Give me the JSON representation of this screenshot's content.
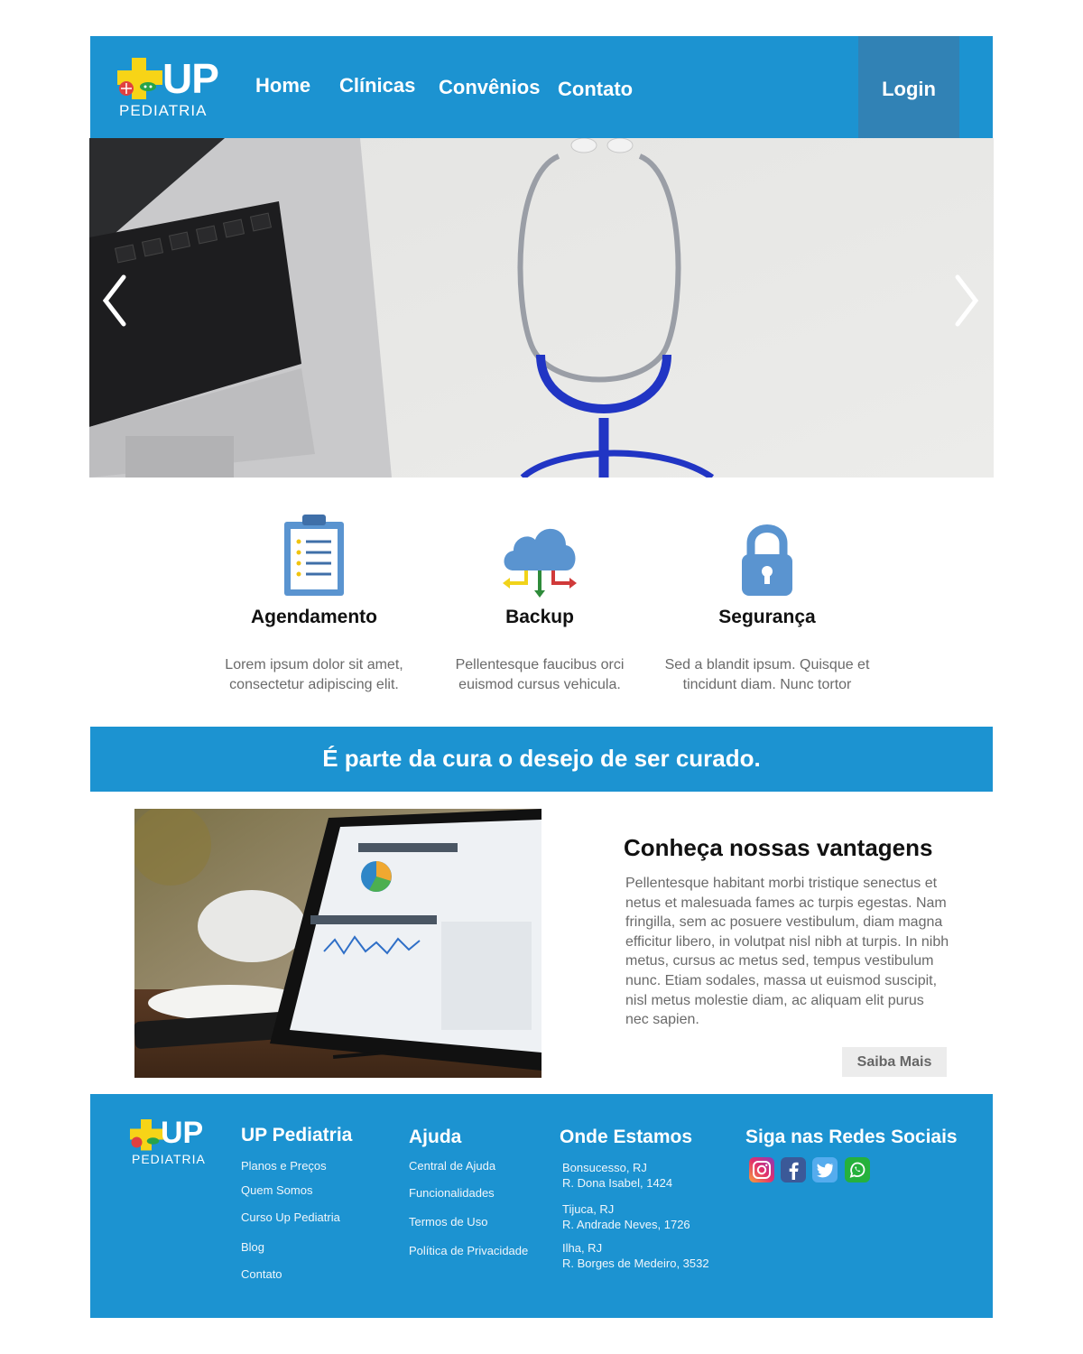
{
  "brand": {
    "mark": "UP",
    "name": "PEDIATRIA"
  },
  "nav": {
    "home": "Home",
    "clinicas": "Clínicas",
    "convenios": "Convênios",
    "contato": "Contato",
    "login": "Login"
  },
  "features": [
    {
      "title": "Agendamento",
      "line1": "Lorem ipsum dolor sit amet,",
      "line2": "consectetur adipiscing elit."
    },
    {
      "title": "Backup",
      "line1": "Pellentesque faucibus orci",
      "line2": "euismod cursus vehicula."
    },
    {
      "title": "Segurança",
      "line1": "Sed a blandit ipsum. Quisque et",
      "line2": "tincidunt diam. Nunc tortor"
    }
  ],
  "banner": {
    "text": "É parte da cura o desejo de ser curado."
  },
  "advantages": {
    "title": "Conheça nossas vantagens",
    "body": "Pellentesque habitant morbi tristique senectus et netus et malesuada fames ac turpis egestas. Nam fringilla, sem ac posuere vestibulum, diam magna efficitur libero, in volutpat nisl nibh at turpis. In nibh metus, cursus ac metus sed, tempus vestibulum nunc. Etiam sodales, massa ut euismod suscipit, nisl metus molestie diam, ac aliquam elit purus nec sapien.",
    "button": "Saiba Mais"
  },
  "footer": {
    "col1": {
      "title": "UP Pediatria",
      "links": [
        "Planos e Preços",
        "Quem Somos",
        "Curso Up Pediatria",
        "Blog",
        "Contato"
      ]
    },
    "col2": {
      "title": "Ajuda",
      "links": [
        "Central de Ajuda",
        "Funcionalidades",
        "Termos de Uso",
        "Política de Privacidade"
      ]
    },
    "col3": {
      "title": "Onde Estamos",
      "addresses": [
        {
          "city": "Bonsucesso, RJ",
          "street": "R. Dona Isabel, 1424"
        },
        {
          "city": "Tijuca, RJ",
          "street": "R. Andrade Neves, 1726"
        },
        {
          "city": "Ilha, RJ",
          "street": "R. Borges de Medeiro, 3532"
        }
      ]
    },
    "col4": {
      "title": "Siga nas Redes Sociais"
    }
  },
  "colors": {
    "primary": "#1c93d1",
    "login_bg": "#3182b5",
    "logo_yellow": "#f7d417",
    "icon_blue": "#5a94d0"
  },
  "icons": [
    "plus-logo-icon",
    "clipboard-icon",
    "cloud-icon",
    "padlock-icon",
    "chevron-left-icon",
    "chevron-right-icon",
    "instagram-icon",
    "facebook-icon",
    "twitter-icon",
    "whatsapp-icon"
  ]
}
